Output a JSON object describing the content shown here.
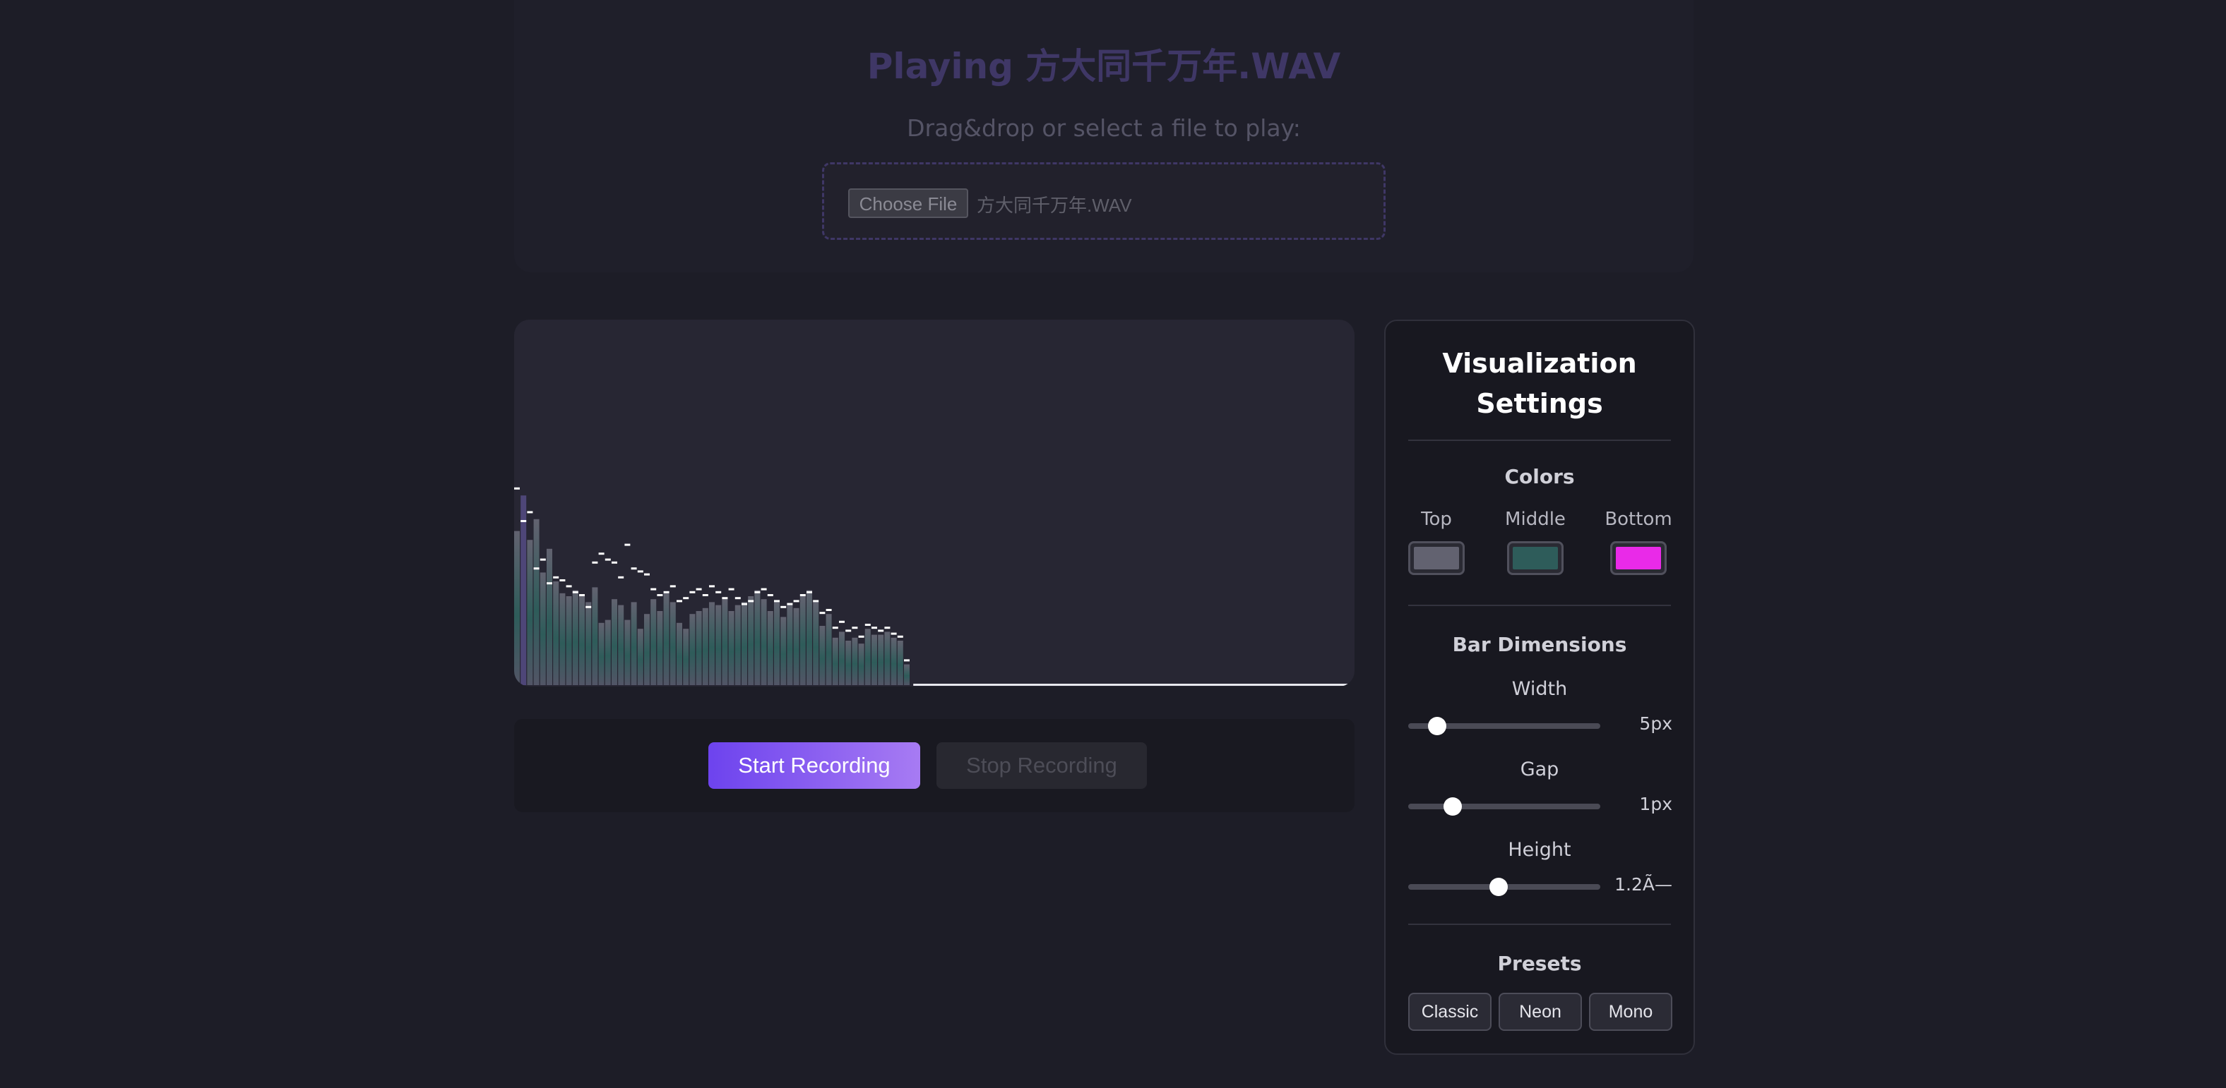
{
  "player": {
    "title": "Playing 方大同千万年.WAV",
    "subtitle": "Drag&drop or select a file to play:",
    "choose_label": "Choose File",
    "file_name": "方大同千万年.WAV"
  },
  "recording": {
    "start_label": "Start Recording",
    "stop_label": "Stop Recording"
  },
  "settings": {
    "title_line1": "Visualization",
    "title_line2": "Settings",
    "colors": {
      "heading": "Colors",
      "top_label": "Top",
      "middle_label": "Middle",
      "bottom_label": "Bottom",
      "top_color": "#626270",
      "middle_color": "#2e5c5a",
      "bottom_color": "#e92ae8"
    },
    "bar_dimensions": {
      "heading": "Bar Dimensions",
      "width_label": "Width",
      "width_value": "5px",
      "width_level": 0.15,
      "gap_label": "Gap",
      "gap_value": "1px",
      "gap_level": 0.23,
      "height_label": "Height",
      "height_value": "1.2Ã—",
      "height_level": 0.47
    },
    "presets": {
      "heading": "Presets",
      "items": [
        "Classic",
        "Neon",
        "Mono"
      ]
    }
  },
  "visualizer": {
    "bar_levels": [
      0.52,
      0.64,
      0.49,
      0.56,
      0.38,
      0.46,
      0.35,
      0.31,
      0.3,
      0.32,
      0.3,
      0.28,
      0.33,
      0.21,
      0.22,
      0.29,
      0.27,
      0.22,
      0.28,
      0.19,
      0.24,
      0.29,
      0.25,
      0.31,
      0.28,
      0.21,
      0.19,
      0.24,
      0.25,
      0.26,
      0.28,
      0.27,
      0.29,
      0.25,
      0.27,
      0.28,
      0.3,
      0.32,
      0.29,
      0.25,
      0.28,
      0.23,
      0.27,
      0.26,
      0.3,
      0.32,
      0.28,
      0.2,
      0.24,
      0.16,
      0.18,
      0.15,
      0.16,
      0.14,
      0.19,
      0.17,
      0.17,
      0.18,
      0.16,
      0.15,
      0.07
    ],
    "peak_levels": [
      0.66,
      0.55,
      0.58,
      0.39,
      0.42,
      0.34,
      0.36,
      0.35,
      0.33,
      0.31,
      0.3,
      0.26,
      0.41,
      0.44,
      0.42,
      0.41,
      0.36,
      0.47,
      0.39,
      0.38,
      0.37,
      0.32,
      0.3,
      0.31,
      0.33,
      0.28,
      0.29,
      0.31,
      0.32,
      0.3,
      0.33,
      0.31,
      0.29,
      0.32,
      0.29,
      0.27,
      0.28,
      0.31,
      0.32,
      0.3,
      0.28,
      0.26,
      0.27,
      0.28,
      0.3,
      0.31,
      0.28,
      0.24,
      0.25,
      0.19,
      0.21,
      0.18,
      0.19,
      0.16,
      0.2,
      0.19,
      0.18,
      0.19,
      0.17,
      0.16,
      0.08
    ]
  }
}
